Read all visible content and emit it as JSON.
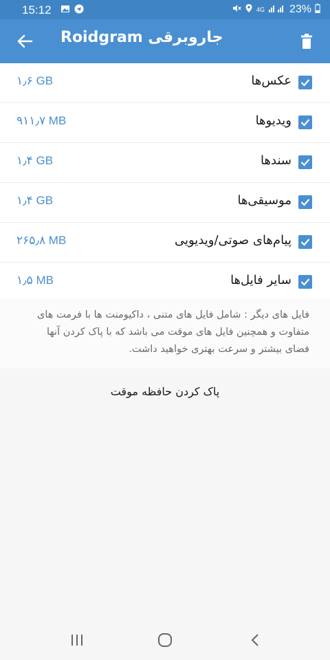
{
  "status_bar": {
    "time": "15:12",
    "network": "4G",
    "battery": "23%",
    "icons": [
      "image-icon",
      "telegram-icon",
      "mute-icon",
      "location-icon",
      "signal-icon",
      "battery-icon"
    ]
  },
  "app_bar": {
    "title": "جاروبرقی Roidgram",
    "back_icon": "arrow-back-icon",
    "delete_icon": "trash-icon",
    "color": "#4a8fd1"
  },
  "items": [
    {
      "label": "عکس‌ها",
      "size": "۱٫۶ GB",
      "checked": true
    },
    {
      "label": "ویدیوها",
      "size": "۹۱۱٫۷ MB",
      "checked": true
    },
    {
      "label": "سندها",
      "size": "۱٫۴ GB",
      "checked": true
    },
    {
      "label": "موسیقی‌ها",
      "size": "۱٫۴ GB",
      "checked": true
    },
    {
      "label": "پیام‌های صوتی/ویدیویی",
      "size": "۲۶۵٫۸ MB",
      "checked": true
    },
    {
      "label": "سایر فایل‌ها",
      "size": "۱٫۵ MB",
      "checked": true
    }
  ],
  "info_text": "فایل های دیگر : شامل فایل های متنی ، داکیومنت ها با فرمت های متفاوت و همچنین فایل های موقت می باشد که با پاک کردن آنها فضای بیشتر و سرعت بهتری خواهید داشت.",
  "clear_cache_label": "پاک کردن حافظه موقت",
  "nav": {
    "recents_icon": "recents-icon",
    "home_icon": "home-icon",
    "back_icon": "nav-back-icon"
  }
}
